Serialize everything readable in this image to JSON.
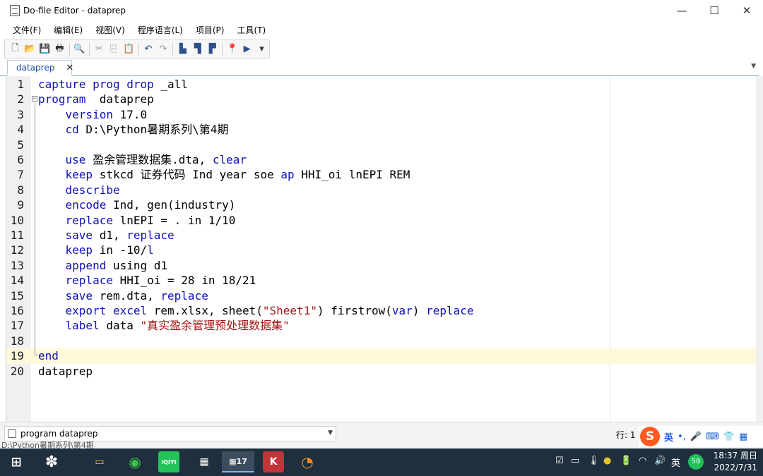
{
  "window": {
    "title": "Do-file Editor - dataprep",
    "minimize": "—",
    "maximize": "☐",
    "close": "✕"
  },
  "menu": [
    "文件(F)",
    "编辑(E)",
    "视图(V)",
    "程序语言(L)",
    "项目(P)",
    "工具(T)"
  ],
  "toolbar": {
    "new": "🗋",
    "open": "📂",
    "save": "💾",
    "print": "🖶",
    "find": "🔍",
    "cut": "✂",
    "copy": "⎘",
    "paste": "📋",
    "undo": "↶",
    "redo": "↷",
    "bm1": "▙",
    "bm2": "▜",
    "bm3": "▛",
    "pin": "📍",
    "run": "▶",
    "dropdown": "▾"
  },
  "tab": {
    "label": "dataprep",
    "close": "✕",
    "menu": "▼"
  },
  "editor": {
    "lines": [
      {
        "n": "1",
        "parts": [
          [
            "kw",
            "capture prog drop"
          ],
          [
            "t",
            " _all"
          ]
        ]
      },
      {
        "n": "2",
        "parts": [
          [
            "kw",
            "program"
          ],
          [
            "t",
            "  dataprep"
          ]
        ]
      },
      {
        "n": "3",
        "parts": [
          [
            "t",
            "    "
          ],
          [
            "kw",
            "version"
          ],
          [
            "t",
            " 17.0"
          ]
        ]
      },
      {
        "n": "4",
        "parts": [
          [
            "t",
            "    "
          ],
          [
            "kw",
            "cd"
          ],
          [
            "t",
            " D:\\Python暑期系列\\第4期"
          ]
        ]
      },
      {
        "n": "5",
        "parts": [
          [
            "t",
            ""
          ]
        ]
      },
      {
        "n": "6",
        "parts": [
          [
            "t",
            "    "
          ],
          [
            "kw",
            "use"
          ],
          [
            "t",
            " 盈余管理数据集.dta, "
          ],
          [
            "kw",
            "clear"
          ]
        ]
      },
      {
        "n": "7",
        "parts": [
          [
            "t",
            "    "
          ],
          [
            "kw",
            "keep"
          ],
          [
            "t",
            " stkcd 证券代码 Ind year soe "
          ],
          [
            "kw",
            "ap"
          ],
          [
            "t",
            " HHI_oi lnEPI REM"
          ]
        ]
      },
      {
        "n": "8",
        "parts": [
          [
            "t",
            "    "
          ],
          [
            "kw",
            "describe"
          ]
        ]
      },
      {
        "n": "9",
        "parts": [
          [
            "t",
            "    "
          ],
          [
            "kw",
            "encode"
          ],
          [
            "t",
            " Ind, gen(industry)"
          ]
        ]
      },
      {
        "n": "10",
        "parts": [
          [
            "t",
            "    "
          ],
          [
            "kw",
            "replace"
          ],
          [
            "t",
            " lnEPI = . in 1/10"
          ]
        ]
      },
      {
        "n": "11",
        "parts": [
          [
            "t",
            "    "
          ],
          [
            "kw",
            "save"
          ],
          [
            "t",
            " d1, "
          ],
          [
            "kw",
            "replace"
          ]
        ]
      },
      {
        "n": "12",
        "parts": [
          [
            "t",
            "    "
          ],
          [
            "kw",
            "keep"
          ],
          [
            "t",
            " in -10/"
          ],
          [
            "kw",
            "l"
          ]
        ]
      },
      {
        "n": "13",
        "parts": [
          [
            "t",
            "    "
          ],
          [
            "kw",
            "append"
          ],
          [
            "t",
            " using d1"
          ]
        ]
      },
      {
        "n": "14",
        "parts": [
          [
            "t",
            "    "
          ],
          [
            "kw",
            "replace"
          ],
          [
            "t",
            " HHI_oi = 28 in 18/21"
          ]
        ]
      },
      {
        "n": "15",
        "parts": [
          [
            "t",
            "    "
          ],
          [
            "kw",
            "save"
          ],
          [
            "t",
            " rem.dta, "
          ],
          [
            "kw",
            "replace"
          ]
        ]
      },
      {
        "n": "16",
        "parts": [
          [
            "t",
            "    "
          ],
          [
            "kw",
            "export excel"
          ],
          [
            "t",
            " rem.xlsx, sheet("
          ],
          [
            "str",
            "\"Sheet1\""
          ],
          [
            "t",
            ") firstrow("
          ],
          [
            "kw",
            "var"
          ],
          [
            "t",
            ") "
          ],
          [
            "kw",
            "replace"
          ]
        ]
      },
      {
        "n": "17",
        "parts": [
          [
            "t",
            "    "
          ],
          [
            "kw",
            "label"
          ],
          [
            "t",
            " data "
          ],
          [
            "str",
            "\"真实盈余管理预处理数据集\""
          ]
        ]
      },
      {
        "n": "18",
        "parts": [
          [
            "t",
            ""
          ]
        ]
      },
      {
        "n": "19",
        "parts": [
          [
            "kw",
            "end"
          ]
        ]
      },
      {
        "n": "20",
        "parts": [
          [
            "t",
            "dataprep"
          ]
        ]
      }
    ],
    "current_line": 19
  },
  "status": {
    "function_select": "program  dataprep",
    "position": "行: 1",
    "path_underlay": "D:\\Python暑期系列\\第4期"
  },
  "ime": {
    "logo": "S",
    "mode": "英",
    "punct": "•,",
    "mic": "🎤",
    "kbd": "⌨",
    "shirt": "👕",
    "grid": "▦"
  },
  "taskbar": {
    "start": "⊞",
    "apps": [
      "✽",
      "▭",
      "◉",
      "iQIYI",
      "▦",
      "▦17",
      "K",
      "◔"
    ],
    "tray": [
      "☑",
      "▭",
      "🌡",
      "●",
      "🔋",
      "◠",
      "🔊",
      "英"
    ],
    "badge": "58",
    "time": "18:37 周日",
    "date": "2022/7/31"
  }
}
